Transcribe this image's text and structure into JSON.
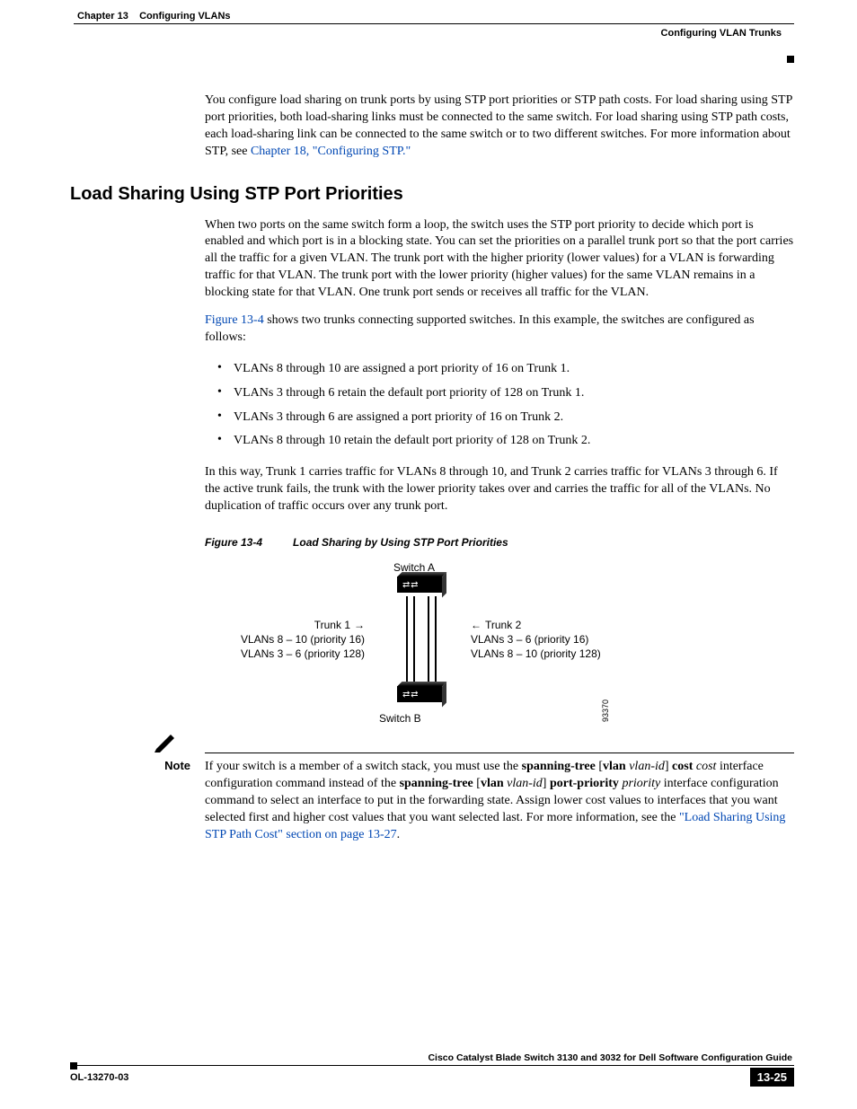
{
  "header": {
    "chapter": "Chapter 13",
    "title": "Configuring VLANs",
    "section": "Configuring VLAN Trunks"
  },
  "intro": {
    "p1a": "You configure load sharing on trunk ports by using STP port priorities or STP path costs. For load sharing using STP port priorities, both load-sharing links must be connected to the same switch. For load sharing using STP path costs, each load-sharing link can be connected to the same switch or to two different switches. For more information about STP, see ",
    "p1link": "Chapter 18, \"Configuring STP.\""
  },
  "heading": "Load Sharing Using STP Port Priorities",
  "body": {
    "p2": "When two ports on the same switch form a loop, the switch uses the STP port priority to decide which port is enabled and which port is in a blocking state. You can set the priorities on a parallel trunk port so that the port carries all the traffic for a given VLAN. The trunk port with the higher priority (lower values) for a VLAN is forwarding traffic for that VLAN. The trunk port with the lower priority (higher values) for the same VLAN remains in a blocking state for that VLAN. One trunk port sends or receives all traffic for the VLAN.",
    "p3a": "Figure 13-4",
    "p3b": " shows two trunks connecting supported switches. In this example, the switches are configured as follows:",
    "bullets": [
      "VLANs 8 through 10 are assigned a port priority of 16 on Trunk 1.",
      "VLANs 3 through 6 retain the default port priority of 128 on Trunk 1.",
      "VLANs 3 through 6 are assigned a port priority of 16 on Trunk 2.",
      "VLANs 8 through 10 retain the default port priority of 128 on Trunk 2."
    ],
    "p4": "In this way, Trunk 1 carries traffic for VLANs 8 through 10, and Trunk 2 carries traffic for VLANs 3 through 6. If the active trunk fails, the trunk with the lower priority takes over and carries the traffic for all of the VLANs. No duplication of traffic occurs over any trunk port."
  },
  "figure": {
    "num": "Figure 13-4",
    "title": "Load Sharing by Using STP Port Priorities",
    "switchA": "Switch A",
    "switchB": "Switch B",
    "trunk1": "Trunk 1",
    "trunk2": "Trunk 2",
    "left1": "VLANs 8 – 10 (priority 16)",
    "left2": "VLANs 3 – 6 (priority 128)",
    "right1": "VLANs 3 – 6 (priority 16)",
    "right2": "VLANs 8 – 10 (priority 128)",
    "id": "93370"
  },
  "note": {
    "label": "Note",
    "t1": "If your switch is a member of a switch stack, you must use the ",
    "cmd1a": "spanning-tree",
    "cmd1b": "vlan",
    "cmd1c": "vlan-id",
    "cmd1d": "cost",
    "cmd1e": "cost",
    "t2": " interface configuration command instead of the ",
    "cmd2a": "spanning-tree",
    "cmd2b": "vlan",
    "cmd2c": "vlan-id",
    "cmd2d": "port-priority",
    "cmd2e": "priority",
    "t3": " interface configuration command to select an interface to put in the forwarding state. Assign lower cost values to interfaces that you want selected first and higher cost values that you want selected last. For more information, see the ",
    "link": "\"Load Sharing Using STP Path Cost\" section on page 13-27",
    "t4": "."
  },
  "footer": {
    "guide": "Cisco Catalyst Blade Switch 3130 and 3032 for Dell Software Configuration Guide",
    "docnum": "OL-13270-03",
    "pagenum": "13-25"
  }
}
